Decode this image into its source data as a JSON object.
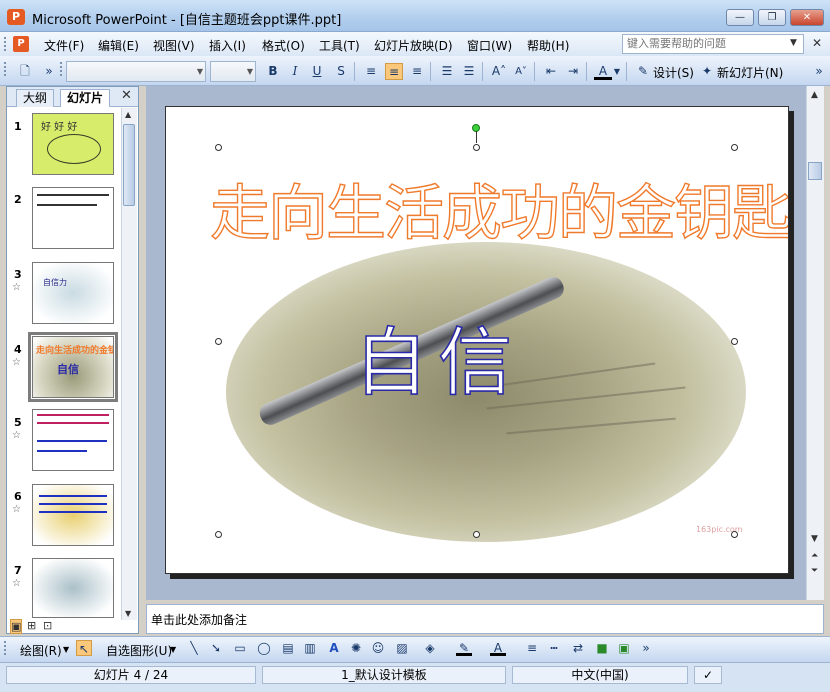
{
  "window": {
    "app_name": "Microsoft PowerPoint",
    "title": "Microsoft PowerPoint - [自信主题班会ppt课件.ppt]",
    "minimize": "—",
    "restore": "❐",
    "close": "✕"
  },
  "menubar": {
    "items": [
      "文件(F)",
      "编辑(E)",
      "视图(V)",
      "插入(I)",
      "格式(O)",
      "工具(T)",
      "幻灯片放映(D)",
      "窗口(W)",
      "帮助(H)"
    ],
    "help_placeholder": "键入需要帮助的问题"
  },
  "toolbar": {
    "design_label": "设计(S)",
    "new_slide_label": "新幻灯片(N)",
    "font_name": "",
    "font_size": "",
    "align_center_active": true
  },
  "left_panel": {
    "tabs": [
      "大纲",
      "幻灯片"
    ],
    "active_tab": "幻灯片",
    "close": "✕",
    "slides": [
      {
        "number": "1",
        "text": "好 好 好"
      },
      {
        "number": "2",
        "text": ""
      },
      {
        "number": "3",
        "text": "自信力"
      },
      {
        "number": "4",
        "text": "走向生活成功的金钥匙",
        "sub": "自信",
        "selected": true
      },
      {
        "number": "5",
        "text": ""
      },
      {
        "number": "6",
        "text": ""
      },
      {
        "number": "7",
        "text": ""
      }
    ]
  },
  "slide": {
    "title": "走向生活成功的金钥匙",
    "subtitle": "自信",
    "watermark": "163pic.com",
    "colors": {
      "title_stroke": "#f07a2c",
      "subtitle_stroke": "#2a2aa8"
    }
  },
  "notes": {
    "placeholder": "单击此处添加备注"
  },
  "drawing_toolbar": {
    "draw_label": "绘图(R)",
    "autoshapes_label": "自选图形(U)"
  },
  "statusbar": {
    "slide_position": "幻灯片 4 / 24",
    "template": "1_默认设计模板",
    "language": "中文(中国)"
  }
}
